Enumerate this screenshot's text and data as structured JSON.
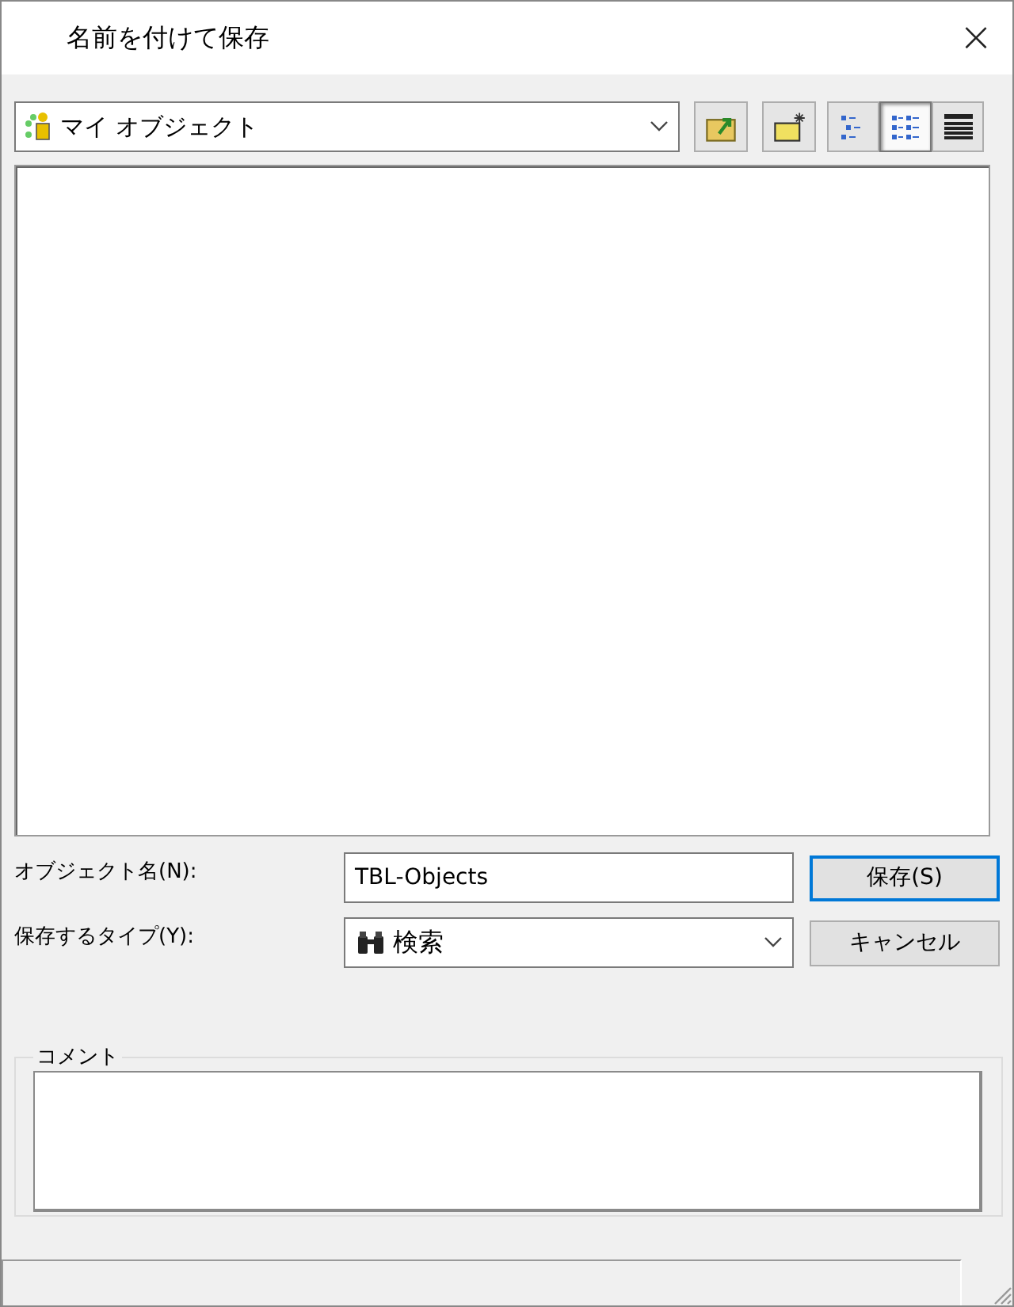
{
  "window": {
    "title": "名前を付けて保存",
    "close": "×"
  },
  "location": {
    "value": "マイ オブジェクト"
  },
  "view_buttons": [
    {
      "kind": "list",
      "selected": false
    },
    {
      "kind": "details",
      "selected": true
    },
    {
      "kind": "table",
      "selected": false
    }
  ],
  "name_field": {
    "label": "オブジェクト名(N):",
    "value": "TBL-Objects"
  },
  "type_field": {
    "label": "保存するタイプ(Y):",
    "value": "検索"
  },
  "buttons": [
    {
      "label": "保存(S)",
      "default": true
    },
    {
      "label": "キャンセル",
      "default": false
    }
  ],
  "comment": {
    "legend": "コメント"
  }
}
